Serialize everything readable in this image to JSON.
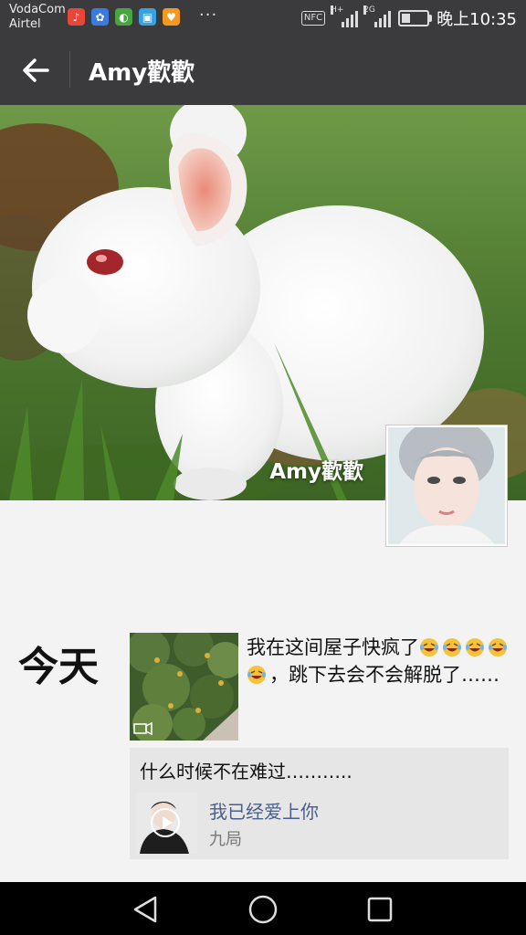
{
  "status_bar": {
    "carrier_1": "VodaCom",
    "carrier_2": "Airtel",
    "nfc": "NFC",
    "net_1": "H+",
    "net_2": "2G",
    "time": "晚上10:35",
    "more": "···",
    "apps": [
      {
        "icon": "music-app-icon",
        "color": "#e8463a"
      },
      {
        "icon": "baidu-paw-icon",
        "color": "#3b7be0"
      },
      {
        "icon": "browser-app-icon",
        "color": "#49a541"
      },
      {
        "icon": "gift-box-icon",
        "color": "#3aa0e0"
      },
      {
        "icon": "store-app-icon",
        "color": "#f39a1e"
      }
    ],
    "battery_level": 0.35
  },
  "header": {
    "back_icon": "back-arrow-icon",
    "title": "Amy歡歡"
  },
  "profile": {
    "cover_name": "Amy歡歡",
    "avatar_icon": "profile-avatar"
  },
  "timeline": {
    "day_label": "今天",
    "post": {
      "text_part1": "我在这间屋子快疯了",
      "text_part2": "，跳下去会不会解脱了……",
      "emoji_icon": "laughing-crying-emoji-icon",
      "thumb_icon": "video-icon"
    },
    "share": {
      "text": "什么时候不在难过………..",
      "song_title": "我已经爱上你",
      "artist": "九局",
      "play_icon": "play-icon"
    }
  },
  "navbar": {
    "back_icon": "nav-back-triangle-icon",
    "home_icon": "nav-home-circle-icon",
    "recents_icon": "nav-recents-square-icon"
  }
}
